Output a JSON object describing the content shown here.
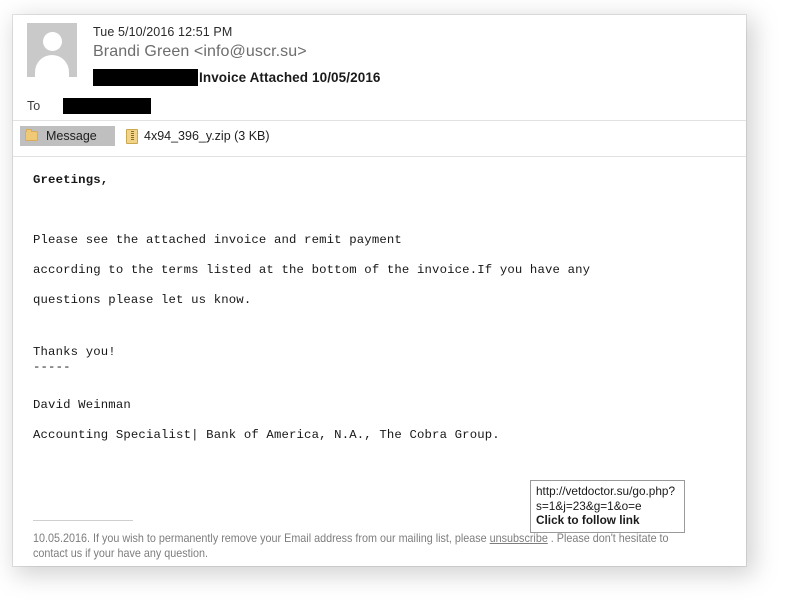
{
  "email": {
    "avatar": {
      "icon": "person-silhouette-icon",
      "alt": "Sender avatar placeholder"
    },
    "header": {
      "date": "Tue 5/10/2016 12:51 PM",
      "from": "Brandi Green <info@uscr.su>",
      "subject_redacted": "",
      "subject": "Invoice Attached 10/05/2016",
      "to_label": "To",
      "to_redacted": ""
    },
    "tabs": {
      "message_tab_label": "Message",
      "message_tab_icon": "folder-icon"
    },
    "attachment": {
      "icon": "zip-file-icon",
      "label": "4x94_396_y.zip (3 KB)",
      "filename": "4x94_396_y.zip",
      "size": "3 KB"
    },
    "body": {
      "greeting": "Greetings,",
      "paragraph_line_1": "Please see the attached invoice and remit payment",
      "paragraph_line_2": "according to the terms listed at the bottom of the invoice.If you have any",
      "paragraph_line_3": "questions please let us know.",
      "closing": "Thanks you!",
      "separator": "-----",
      "signature_name": "David Weinman",
      "signature_title": "Accounting Specialist| Bank of America, N.A., The Cobra Group."
    },
    "footer": {
      "text_before_link": "10.05.2016. If you wish to permanently remove your Email address from our mailing list, please ",
      "link_text": "unsubscribe",
      "text_after_link": " . Please don't hesitate to contact us if your have any question."
    },
    "tooltip": {
      "url": "http://vetdoctor.su/go.php?s=1&j=23&g=1&o=e",
      "cta": "Click to follow link"
    },
    "colors": {
      "panel_background": "#ffffff",
      "avatar_fill": "#c9c9c9",
      "redaction": "#000000",
      "tab_background": "#bfbfbf",
      "separator": "#e2e2e2",
      "footer_text": "#7d7d7d",
      "body_text": "#171717",
      "from_text": "#6d6d6d",
      "attachment_icon": "#f2d488",
      "tooltip_border": "#9a9a9a"
    }
  }
}
